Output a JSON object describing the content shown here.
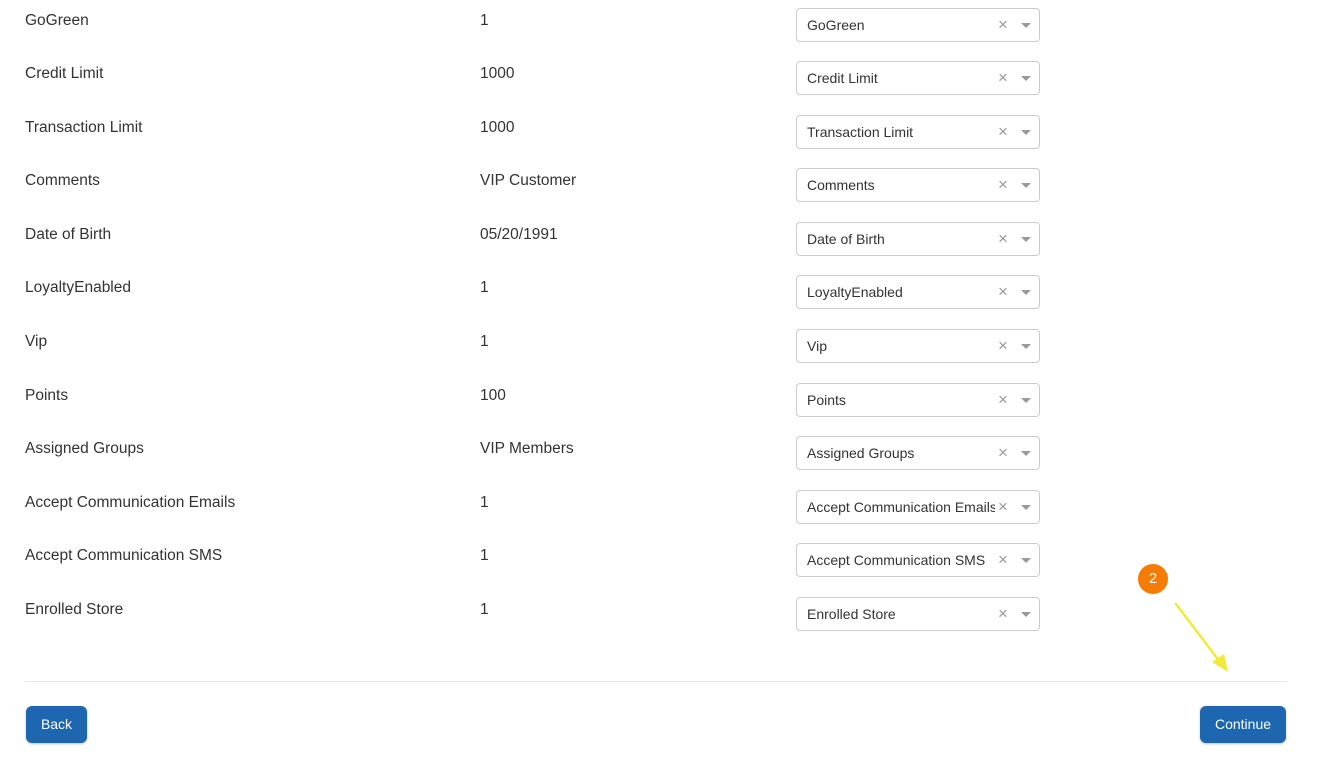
{
  "fields": [
    {
      "name": "GoGreen",
      "value": "1",
      "mapped": "GoGreen"
    },
    {
      "name": "Credit Limit",
      "value": "1000",
      "mapped": "Credit Limit"
    },
    {
      "name": "Transaction Limit",
      "value": "1000",
      "mapped": "Transaction Limit"
    },
    {
      "name": "Comments",
      "value": "VIP Customer",
      "mapped": "Comments"
    },
    {
      "name": "Date of Birth",
      "value": "05/20/1991",
      "mapped": "Date of Birth"
    },
    {
      "name": "LoyaltyEnabled",
      "value": "1",
      "mapped": "LoyaltyEnabled"
    },
    {
      "name": "Vip",
      "value": "1",
      "mapped": "Vip"
    },
    {
      "name": "Points",
      "value": "100",
      "mapped": "Points"
    },
    {
      "name": "Assigned Groups",
      "value": "VIP Members",
      "mapped": "Assigned Groups"
    },
    {
      "name": "Accept Communication Emails",
      "value": "1",
      "mapped": "Accept Communication Emails"
    },
    {
      "name": "Accept Communication SMS",
      "value": "1",
      "mapped": "Accept Communication SMS"
    },
    {
      "name": "Enrolled Store",
      "value": "1",
      "mapped": "Enrolled Store"
    }
  ],
  "select": {
    "clear_glyph": "×",
    "clear_icon": "close-icon",
    "caret_icon": "caret-down-icon"
  },
  "footer": {
    "back_label": "Back",
    "continue_label": "Continue"
  },
  "annotation": {
    "step_number": "2",
    "badge_color": "#f57c00",
    "arrow_color": "#f2ea3a"
  },
  "colors": {
    "button": "#1d67b1",
    "text": "#333333",
    "border": "#cccccc"
  }
}
